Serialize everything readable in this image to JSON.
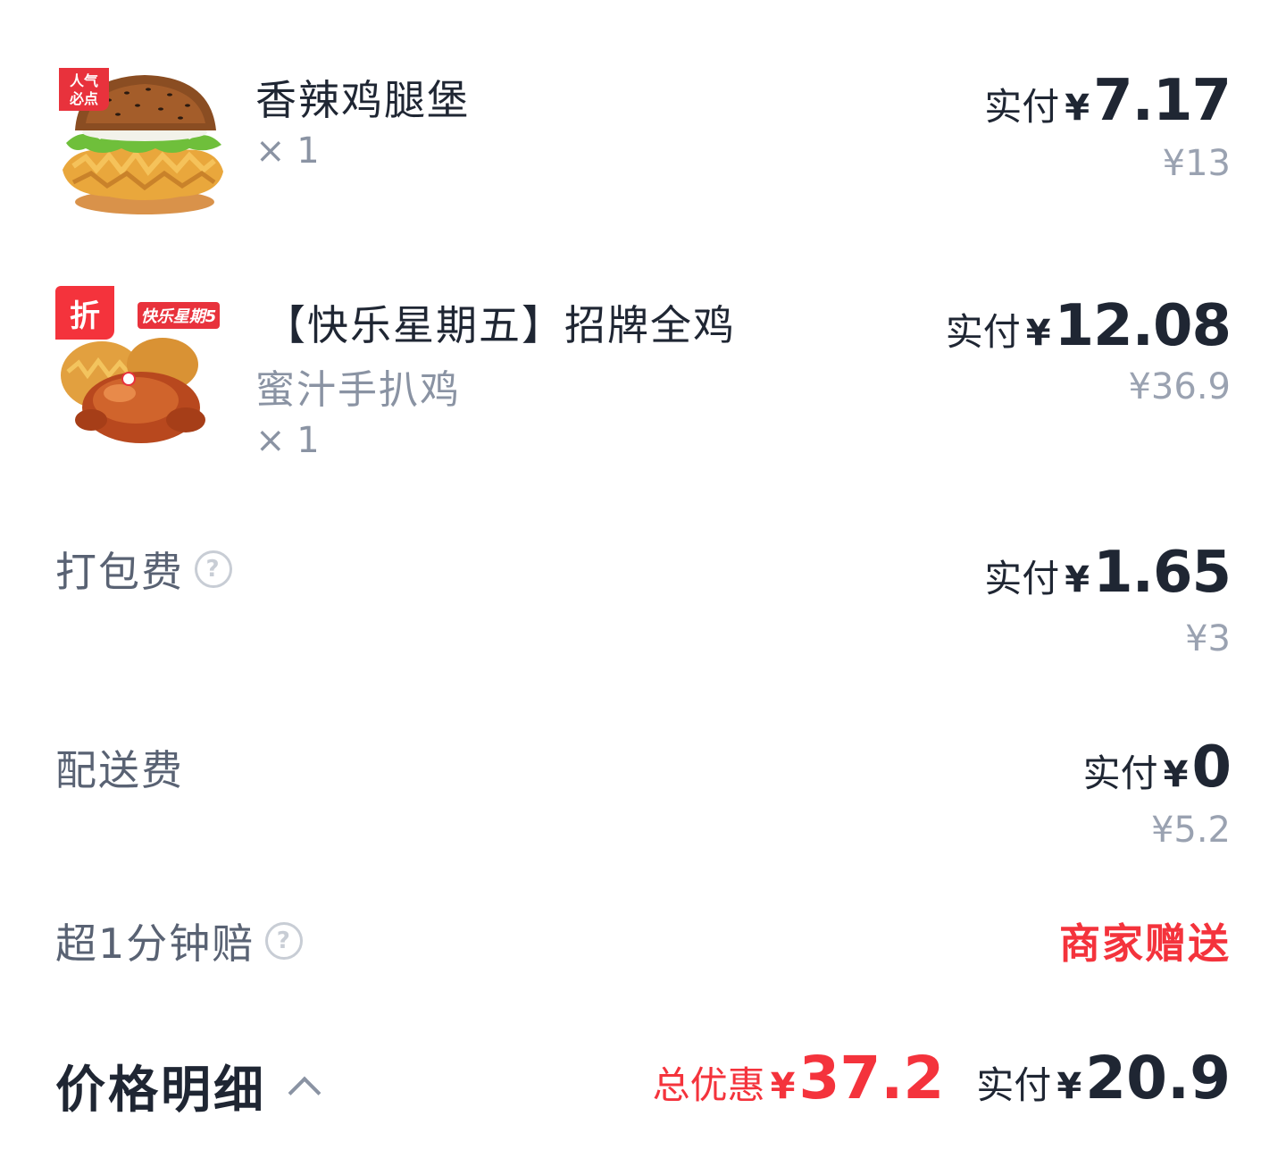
{
  "items": [
    {
      "name": "香辣鸡腿堡",
      "qty": "× 1",
      "pay_label": "实付",
      "currency": "¥",
      "pay_amount": "7.17",
      "original": "¥13",
      "badge_text": "人气必点",
      "image": "burger-image"
    },
    {
      "name": "【快乐星期五】招牌全鸡",
      "spec": "蜜汁手扒鸡",
      "qty": "× 1",
      "pay_label": "实付",
      "currency": "¥",
      "pay_amount": "12.08",
      "original": "¥36.9",
      "badge_text": "折",
      "promo_text": "快乐星期5",
      "image": "roast-chicken-image"
    }
  ],
  "fees": [
    {
      "label": "打包费",
      "help_icon": "question-circle-icon",
      "pay_label": "实付",
      "currency": "¥",
      "pay_amount": "1.65",
      "original": "¥3"
    },
    {
      "label": "配送费",
      "pay_label": "实付",
      "currency": "¥",
      "pay_amount": "0",
      "original": "¥5.2"
    },
    {
      "label": "超1分钟赔",
      "help_icon": "question-circle-icon",
      "value": "商家赠送"
    }
  ],
  "footer": {
    "title": "价格明细",
    "toggle_icon": "chevron-up-icon",
    "discount_label": "总优惠",
    "discount_currency": "¥",
    "discount_amount": "37.2",
    "total_label": "实付",
    "total_currency": "¥",
    "total_amount": "20.9"
  },
  "colors": {
    "accent_red": "#f4333c",
    "text_primary": "#1f2633",
    "text_secondary": "#596273",
    "text_muted": "#9aa2b1"
  }
}
